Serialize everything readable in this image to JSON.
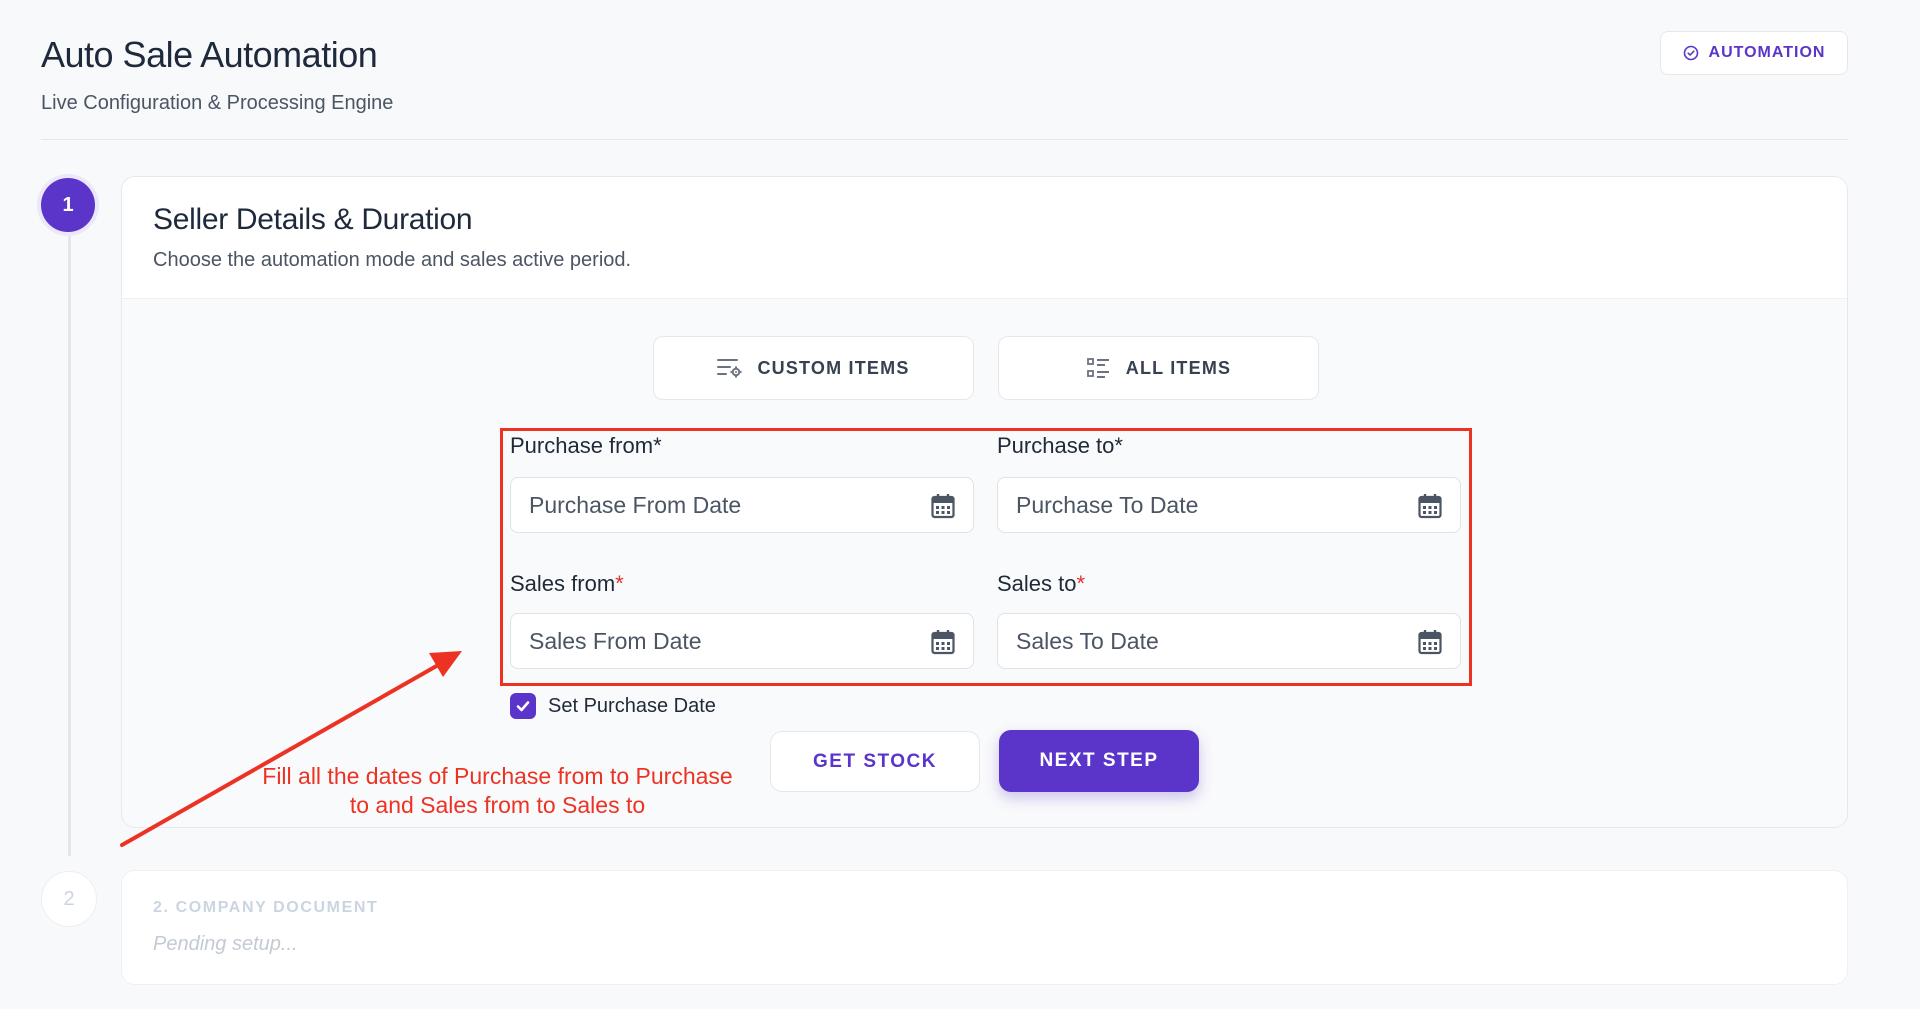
{
  "header": {
    "title": "Auto Sale Automation",
    "subtitle": "Live Configuration & Processing Engine",
    "badge_label": "AUTOMATION"
  },
  "steps": [
    {
      "number": "1",
      "title": "Seller Details & Duration",
      "description": "Choose the automation mode and sales active period.",
      "state": "active"
    },
    {
      "number": "2",
      "title": "2. COMPANY DOCUMENT",
      "status": "Pending setup...",
      "state": "pending"
    }
  ],
  "mode_buttons": {
    "custom_label": "CUSTOM ITEMS",
    "all_label": "ALL ITEMS"
  },
  "fields": {
    "purchase_from": {
      "label": "Purchase from",
      "required_mark": "*",
      "placeholder": "Purchase From Date"
    },
    "purchase_to": {
      "label": "Purchase to",
      "required_mark": "*",
      "placeholder": "Purchase To Date"
    },
    "sales_from": {
      "label": "Sales from",
      "required_mark": "*",
      "placeholder": "Sales From Date"
    },
    "sales_to": {
      "label": "Sales to",
      "required_mark": "*",
      "placeholder": "Sales To Date"
    }
  },
  "checkbox": {
    "label": "Set Purchase Date",
    "checked": true
  },
  "actions": {
    "get_stock_label": "GET STOCK",
    "next_step_label": "NEXT STEP"
  },
  "annotation": {
    "text": "Fill all the dates of Purchase from to Purchase to and Sales from to Sales to"
  },
  "colors": {
    "accent": "#5b34c9",
    "annotation": "#ec3323",
    "required": "#e1332b"
  }
}
